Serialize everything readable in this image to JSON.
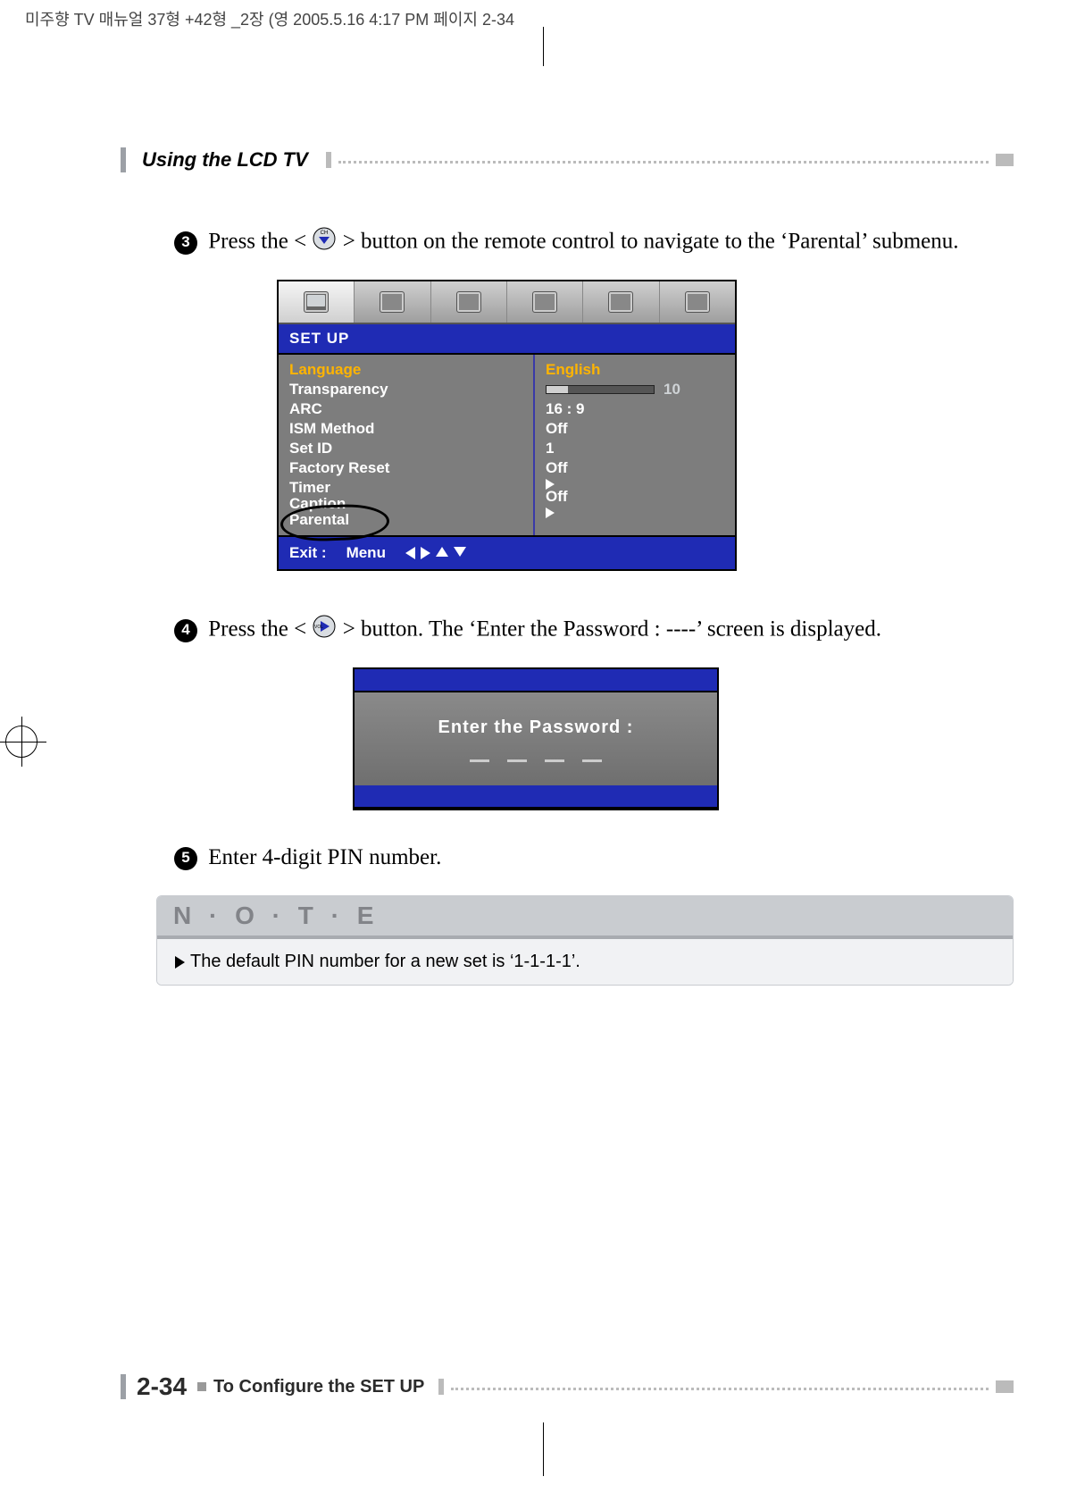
{
  "print_header": "미주향 TV 매뉴얼 37형 +42형 _2장 (영   2005.5.16  4:17 PM  페이지 2-34",
  "header": {
    "section": "Using the LCD TV"
  },
  "steps": {
    "s3_num": "3",
    "s3_pre": "Press the < ",
    "s3_post": " > button on the remote control to navigate to the ‘Parental’ submenu.",
    "s4_num": "4",
    "s4_pre": "Press the < ",
    "s4_post": " > button. The ‘Enter the Password : ----’ screen is displayed.",
    "s5_num": "5",
    "s5_text": "Enter 4-digit PIN number."
  },
  "osd": {
    "title": "SET UP",
    "items": [
      {
        "label": "Language",
        "value": "English",
        "hl": true
      },
      {
        "label": "Transparency",
        "value": "10",
        "slider": true
      },
      {
        "label": "ARC",
        "value": "16 : 9"
      },
      {
        "label": "ISM Method",
        "value": "Off"
      },
      {
        "label": "Set ID",
        "value": "1"
      },
      {
        "label": "Factory Reset",
        "value": "Off"
      },
      {
        "label": "Timer",
        "value": "▶"
      },
      {
        "label": "Caption",
        "value": "Off"
      },
      {
        "label": "Parental",
        "value": "▶",
        "circled": true
      }
    ],
    "nav_exit": "Exit :",
    "nav_menu": "Menu"
  },
  "pwd": {
    "label": "Enter the Password :"
  },
  "note": {
    "title": "N · O · T · E",
    "body": "The default PIN number for a new set is ‘1-1-1-1’."
  },
  "footer": {
    "page": "2-34",
    "title": "To Configure the SET UP"
  }
}
